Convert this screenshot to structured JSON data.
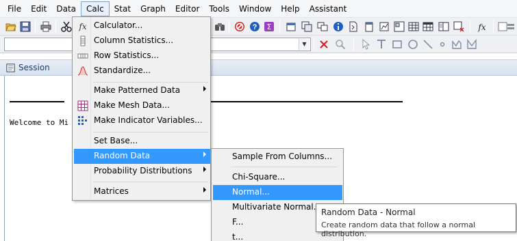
{
  "menubar": {
    "items": [
      "File",
      "Edit",
      "Data",
      "Calc",
      "Stat",
      "Graph",
      "Editor",
      "Tools",
      "Window",
      "Help",
      "Assistant"
    ],
    "open_item": "Calc"
  },
  "toolbar": {
    "icons": [
      "open-icon",
      "save-icon",
      "print-icon",
      "cut-icon",
      "binoculars-icon",
      "stop-icon",
      "help-icon",
      "sigma-icon",
      "session-icon",
      "worksheets-icon",
      "windows-icon",
      "info-icon",
      "report-icon",
      "notepad-icon",
      "graph-icon",
      "layout-icon",
      "table-icon",
      "split-icon",
      "close-graph-icon",
      "fx-icon",
      "vars-icon"
    ],
    "drawing_tools": [
      "cross-icon",
      "magnifier-icon",
      "pointer-icon",
      "text-tool-icon",
      "rectangle-tool-icon",
      "ellipse-tool-icon",
      "line-tool-icon",
      "marker-tool-icon",
      "polyline-tool-icon",
      "polygon-tool-icon"
    ]
  },
  "session": {
    "title": "Session",
    "welcome": "Welcome to Mi"
  },
  "calc_menu": {
    "items": [
      {
        "label": "Calculator...",
        "icon": "fx-icon"
      },
      {
        "label": "Column Statistics...",
        "icon": "column-stats-icon"
      },
      {
        "label": "Row Statistics...",
        "icon": "row-stats-icon"
      },
      {
        "label": "Standardize...",
        "icon": "bell-curve-icon"
      },
      {
        "label": "Make Patterned Data",
        "submenu": true
      },
      {
        "label": "Make Mesh Data...",
        "icon": "mesh-icon"
      },
      {
        "label": "Make Indicator Variables...",
        "icon": "indicator-icon"
      },
      {
        "label": "Set Base..."
      },
      {
        "label": "Random Data",
        "submenu": true,
        "highlighted": true
      },
      {
        "label": "Probability Distributions",
        "submenu": true
      },
      {
        "label": "Matrices",
        "submenu": true
      }
    ]
  },
  "random_data_menu": {
    "items": [
      {
        "label": "Sample From Columns..."
      },
      {
        "label": "Chi-Square..."
      },
      {
        "label": "Normal...",
        "highlighted": true
      },
      {
        "label": "Multivariate Normal..."
      },
      {
        "label": "F..."
      },
      {
        "label": "t..."
      }
    ]
  },
  "tooltip": {
    "title": "Random Data - Normal",
    "description": "Create random data that follow a normal distribution."
  },
  "colors": {
    "highlight": "#3399ff",
    "menu_bg": "#f0f0f0",
    "stop_red": "#d42020",
    "help_blue": "#1f5fbf",
    "sigma_purple": "#9b3fbf"
  }
}
